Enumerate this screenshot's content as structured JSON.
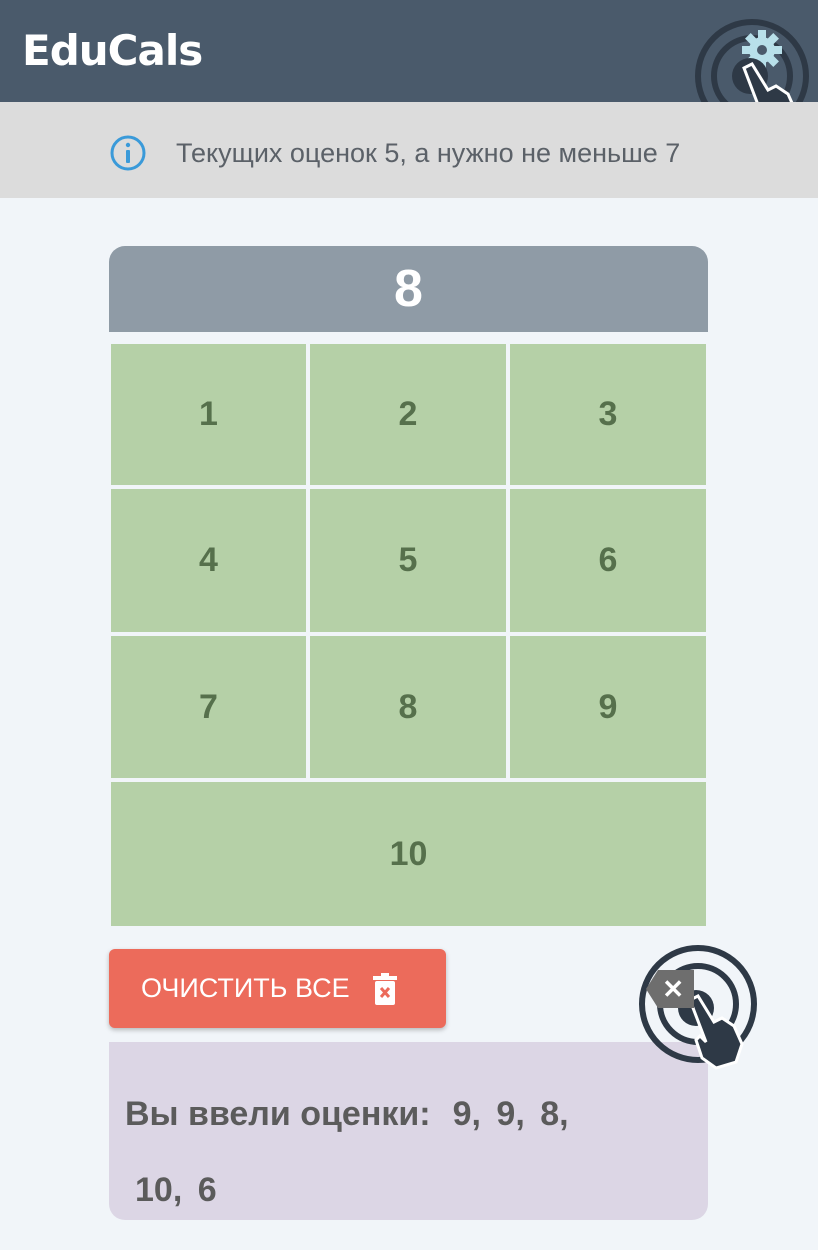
{
  "app": {
    "logo": "EduCals"
  },
  "info": {
    "message": "Текущих оценок 5, а нужно не меньше 7"
  },
  "display": {
    "value": "8"
  },
  "keypad": {
    "keys": [
      "1",
      "2",
      "3",
      "4",
      "5",
      "6",
      "7",
      "8",
      "9",
      "10"
    ]
  },
  "actions": {
    "clear_all_label": "ОЧИСТИТЬ ВСЕ"
  },
  "result": {
    "label": "Вы ввели оценки:",
    "grades_line1": "9,  9,  8,",
    "grades_line2": "10,  6"
  },
  "colors": {
    "header_bg": "#4a5a6b",
    "key_bg": "#b5d0a7",
    "key_text": "#56704c",
    "clear_button": "#ec6b5b",
    "result_bg": "#dcd6e5",
    "display_bg": "#8f9ba6"
  },
  "icons": [
    "settings-gear-icon",
    "tap-hand-icon",
    "info-icon",
    "trash-icon",
    "backspace-icon"
  ]
}
